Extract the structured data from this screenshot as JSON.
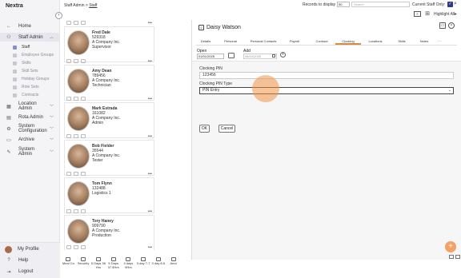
{
  "app": {
    "name": "Nextra"
  },
  "breadcrumb": {
    "parent": "Staff Admin",
    "separator": ">",
    "current": "Staff"
  },
  "topbar": {
    "records_label": "Records to display",
    "records_value": "50",
    "search_placeholder": "Search",
    "current_staff_label": "Current Staff Only:",
    "current_staff_checked": "✓",
    "highlight_label": "Highlight All"
  },
  "sidebar": {
    "items": [
      {
        "label": "Home",
        "icon": "arrow-left-icon"
      },
      {
        "label": "Staff Admin",
        "icon": "people-icon",
        "expanded": true
      },
      {
        "label": "Location Admin",
        "icon": "building-icon"
      },
      {
        "label": "Rota Admin",
        "icon": "calendar-icon"
      },
      {
        "label": "System Configuration",
        "icon": "gear-icon"
      },
      {
        "label": "Archive",
        "icon": "archive-icon"
      },
      {
        "label": "System Admin",
        "icon": "wrench-icon"
      }
    ],
    "sub_items": [
      "Staff",
      "Employee Groups",
      "Skills",
      "Skill Sets",
      "Holiday Groups",
      "Role Sets",
      "Contracts"
    ],
    "bottom": [
      "My Profile",
      "Help",
      "Logout"
    ]
  },
  "staff": [
    {
      "name": "Fred Dale",
      "id": "529318",
      "company": "A Company Inc.",
      "role": "Supervisor"
    },
    {
      "name": "Amy Dean",
      "id": "789456",
      "company": "A Company Inc.",
      "role": "Technician"
    },
    {
      "name": "Mark Estrada",
      "id": "161082",
      "company": "A Company Inc.",
      "role": "Admin"
    },
    {
      "name": "Bob Fielder",
      "id": "35544",
      "company": "A Company Inc.",
      "role": "Tester"
    },
    {
      "name": "Tom Flynn",
      "id": "132488",
      "company": "Logistics 1",
      "role": ""
    },
    {
      "name": "Tory Haney",
      "id": "909790",
      "company": "A Company Inc.",
      "role": "Production"
    }
  ],
  "bottom_toolbar": [
    {
      "label": "Meal Co",
      "icon": "meal-icon"
    },
    {
      "label": "Security",
      "icon": "security-icon"
    },
    {
      "label": "5 Days 38 Hrs",
      "icon": "calendar-icon"
    },
    {
      "label": "5 Days 37.5Hrs",
      "icon": "calendar-icon"
    },
    {
      "label": "4 days 9Hrs",
      "icon": "calendar-icon"
    },
    {
      "label": "3 day 7-7",
      "icon": "calendar-icon"
    },
    {
      "label": "3 day 8-6",
      "icon": "calendar-icon"
    },
    {
      "label": "Amd",
      "icon": "calendar-icon"
    }
  ],
  "detail": {
    "name": "Daisy Watson",
    "tabs": [
      "Details",
      "Personal",
      "Personal Contacts",
      "Payroll",
      "Contract",
      "Clocking",
      "Locations",
      "Skills",
      "Notes",
      "···"
    ],
    "active_tab": "Clocking",
    "open_label": "Open",
    "open_value": "01/01/2025",
    "add_label": "Add",
    "add_placeholder": "08/10/2025",
    "clocking_pin_label": "Clocking PIN",
    "clocking_pin_value": "123456",
    "pin_type_label": "Clocking PIN Type",
    "pin_type_value": "PIN Entry",
    "ok_label": "OK",
    "cancel_label": "Cancel"
  },
  "colors": {
    "accent": "#2f3a8a",
    "click_marker": "#f0a060",
    "fab": "#f4a066",
    "active_tab": "#d98b3a"
  }
}
